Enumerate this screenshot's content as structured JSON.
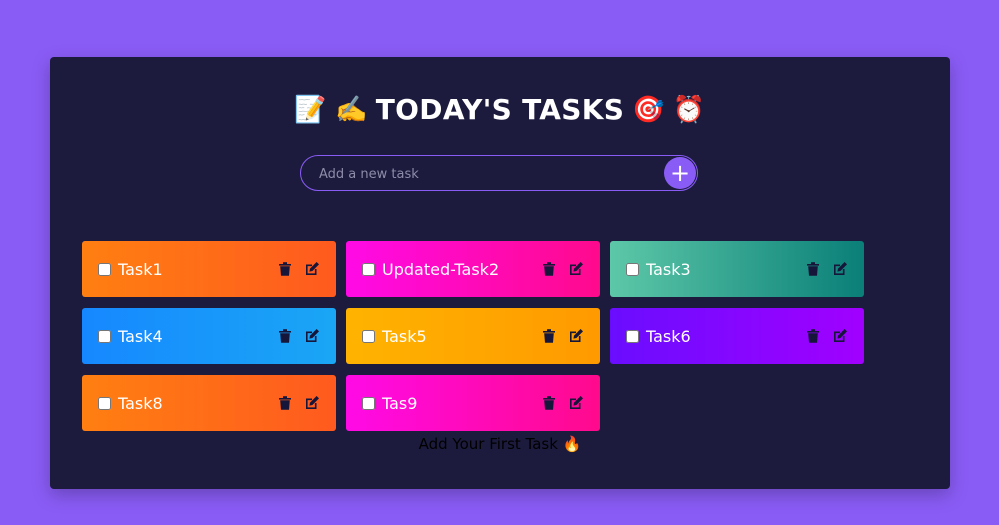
{
  "header": {
    "title": "TODAY'S TASKS",
    "emoji_left_1": "📝",
    "emoji_left_2": "✍️",
    "emoji_right_1": "🎯",
    "emoji_right_2": "⏰"
  },
  "add_task": {
    "placeholder": "Add a new task",
    "value": "",
    "button_label": "+"
  },
  "tasks": [
    {
      "label": "Task1",
      "checked": false,
      "gradient": [
        "#ff7f11",
        "#ff5a1f"
      ]
    },
    {
      "label": "Updated-Task2",
      "checked": false,
      "gradient": [
        "#ff0ae6",
        "#ff0a8c"
      ]
    },
    {
      "label": "Task3",
      "checked": false,
      "gradient": [
        "#5dc8a8",
        "#0a7f78"
      ]
    },
    {
      "label": "Task4",
      "checked": false,
      "gradient": [
        "#1688ff",
        "#1aa6f5"
      ]
    },
    {
      "label": "Task5",
      "checked": false,
      "gradient": [
        "#ffb300",
        "#ff9a00"
      ]
    },
    {
      "label": "Task6",
      "checked": false,
      "gradient": [
        "#6a0dff",
        "#a100ff"
      ]
    },
    {
      "label": "Task8",
      "checked": false,
      "gradient": [
        "#ff7f11",
        "#ff5a1f"
      ]
    },
    {
      "label": "Tas9",
      "checked": false,
      "gradient": [
        "#ff0ae6",
        "#ff0a8c"
      ]
    }
  ],
  "empty_message": "Add Your First Task 🔥",
  "colors": {
    "page_background": "#8a5cf6",
    "panel_background": "#1c1b3e",
    "accent": "#8a5cf6",
    "icon_color": "#16163a"
  },
  "icons": {
    "delete": "trash-icon",
    "edit": "edit-icon"
  }
}
